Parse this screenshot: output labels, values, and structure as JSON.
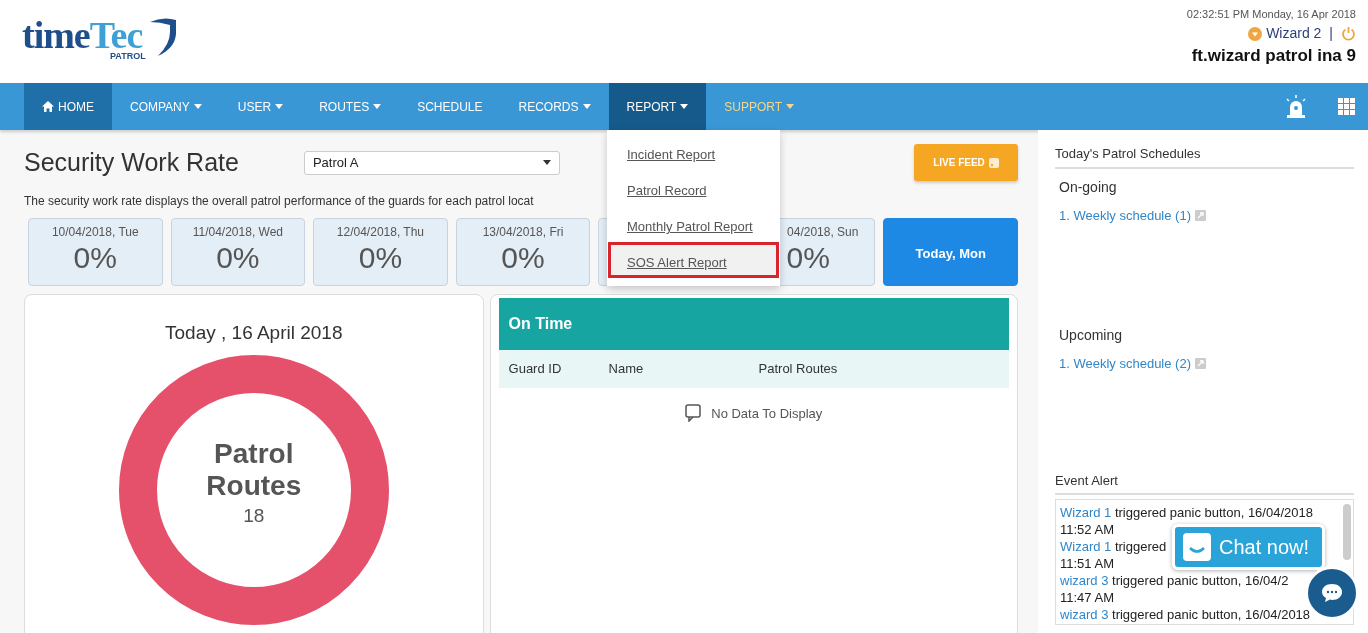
{
  "header": {
    "logo": {
      "main": "time",
      "accent": "Tec",
      "sub": "PATROL"
    },
    "datetime": "02:32:51 PM Monday, 16 Apr 2018",
    "user": "Wizard 2",
    "separator": "|",
    "account": "ft.wizard patrol ina 9"
  },
  "nav": {
    "items": [
      {
        "label": "HOME",
        "kind": "home",
        "selected": true,
        "expanded": false
      },
      {
        "label": "COMPANY",
        "kind": "menu",
        "selected": false,
        "expanded": false
      },
      {
        "label": "USER",
        "kind": "menu",
        "selected": false,
        "expanded": false
      },
      {
        "label": "ROUTES",
        "kind": "menu",
        "selected": false,
        "expanded": false
      },
      {
        "label": "SCHEDULE",
        "kind": "link",
        "selected": false,
        "expanded": false
      },
      {
        "label": "RECORDS",
        "kind": "menu",
        "selected": false,
        "expanded": false
      },
      {
        "label": "REPORT",
        "kind": "menu",
        "selected": false,
        "expanded": true
      },
      {
        "label": "SUPPORT",
        "kind": "accent",
        "selected": false,
        "expanded": false
      }
    ],
    "open_menu": [
      {
        "label": "Incident Report",
        "highlighted": false
      },
      {
        "label": "Patrol Record",
        "highlighted": false
      },
      {
        "label": "Monthly Patrol Report",
        "highlighted": false
      },
      {
        "label": "SOS Alert Report",
        "highlighted": true
      }
    ]
  },
  "page": {
    "title": "Security Work Rate",
    "patrol_select": "Patrol A",
    "live_feed": "LIVE FEED",
    "description": "The security work rate displays the overall patrol performance of the guards for each patrol locat"
  },
  "days": [
    {
      "kind": "day",
      "date": "10/04/2018, Tue",
      "rate": "0%"
    },
    {
      "kind": "day",
      "date": "11/04/2018, Wed",
      "rate": "0%"
    },
    {
      "kind": "day",
      "date": "12/04/2018, Thu",
      "rate": "0%"
    },
    {
      "kind": "day",
      "date": "13/04/2018, Fri",
      "rate": "0%"
    },
    {
      "kind": "covered"
    },
    {
      "kind": "partial",
      "date": "04/2018, Sun",
      "rate": "0%"
    },
    {
      "kind": "today",
      "date": "Today, Mon"
    }
  ],
  "summary": {
    "title": "Today , 16 April 2018",
    "center_title": "Patrol Routes",
    "center_value": "18"
  },
  "on_time": {
    "title": "On Time",
    "columns": [
      "Guard ID",
      "Name",
      "Patrol Routes"
    ],
    "empty": "No Data To Display"
  },
  "sidebar": {
    "title": "Today's Patrol Schedules",
    "sections": [
      {
        "heading": "On-going",
        "links": [
          "1. Weekly schedule (1)"
        ]
      },
      {
        "heading": "Upcoming",
        "links": [
          "1. Weekly schedule (2)"
        ]
      }
    ],
    "event_title": "Event Alert",
    "events": [
      {
        "user": "Wizard 1",
        "text": "triggered panic button, 16/04/2018",
        "time": "11:52 AM"
      },
      {
        "user": "Wizard 1",
        "text": "triggered",
        "time": "11:51 AM"
      },
      {
        "user": "wizard 3",
        "text": "triggered panic button, 16/04/2",
        "time": "11:47 AM"
      },
      {
        "user": "wizard 3",
        "text": "triggered panic button, 16/04/2018"
      }
    ]
  },
  "chat": {
    "label": "Chat now!"
  }
}
